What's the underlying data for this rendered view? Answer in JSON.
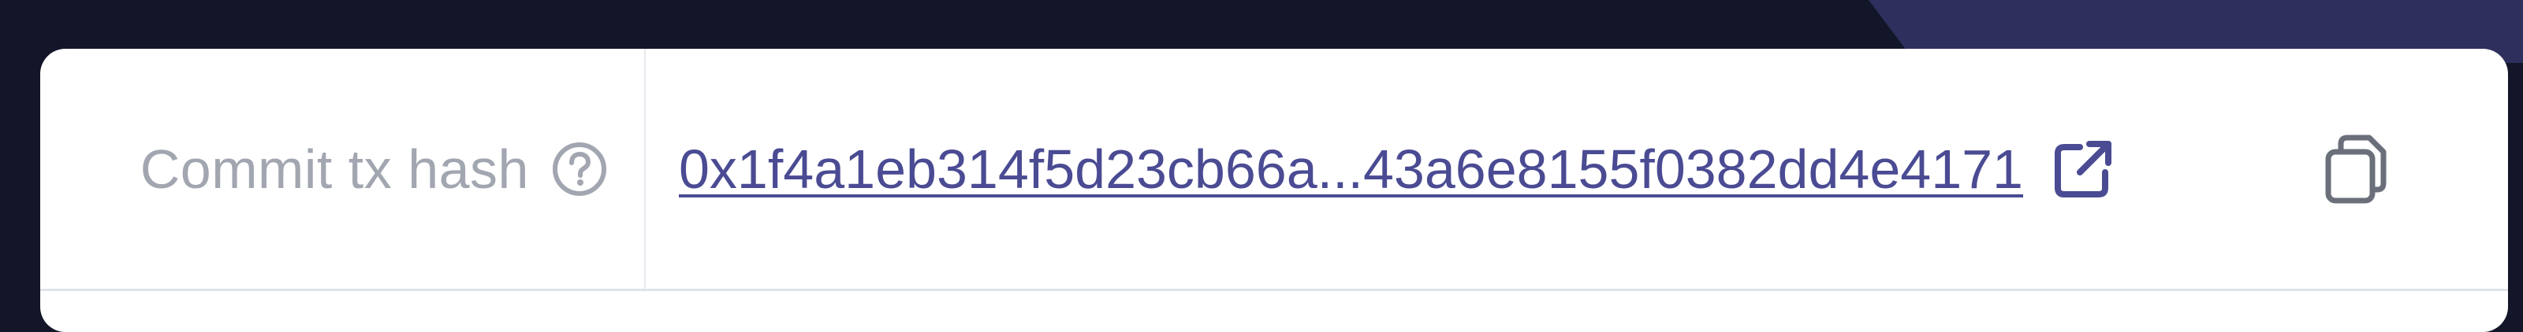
{
  "field": {
    "label": "Commit tx hash",
    "help_icon": "question-circle-icon",
    "value": "0x1f4a1eb314f5d23cb66a...43a6e8155f0382dd4e4171",
    "external_link_icon": "external-link-icon",
    "copy_icon": "copy-icon"
  },
  "colors": {
    "background": "#131629",
    "card": "#ffffff",
    "label": "#a2a6b0",
    "link": "#4a4b93",
    "copy_icon": "#6b6f7a"
  }
}
